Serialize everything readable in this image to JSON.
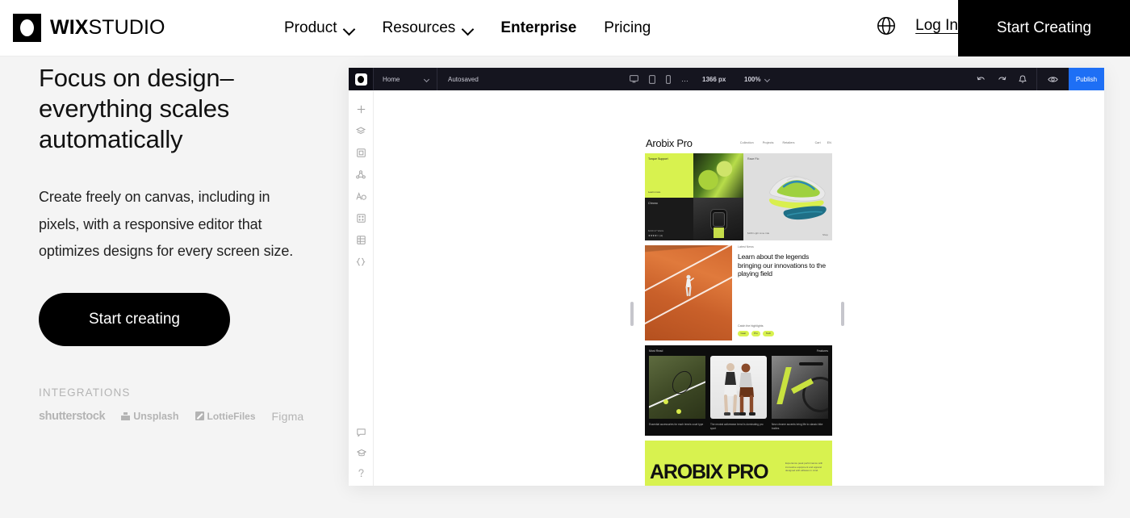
{
  "nav": {
    "brand": {
      "bold": "WIX",
      "light": "STUDIO"
    },
    "links": [
      {
        "label": "Product",
        "has_chevron": true,
        "bold": false
      },
      {
        "label": "Resources",
        "has_chevron": true,
        "bold": false
      },
      {
        "label": "Enterprise",
        "has_chevron": false,
        "bold": true
      },
      {
        "label": "Pricing",
        "has_chevron": false,
        "bold": false
      }
    ],
    "globe_icon": "globe-icon",
    "login": "Log In",
    "cta": "Start Creating"
  },
  "hero": {
    "heading": "Focus on design–everything scales automatically",
    "paragraph": "Create freely on canvas, including in pixels, with a responsive editor that optimizes designs for every screen size.",
    "button": "Start creating",
    "integrations_label": "INTEGRATIONS",
    "integrations": [
      {
        "name": "shutterstock",
        "icon": "shutterstock-logo"
      },
      {
        "name": "Unsplash",
        "icon": "unsplash-icon"
      },
      {
        "name": "LottieFiles",
        "icon": "lottiefiles-icon"
      },
      {
        "name": "Figma",
        "icon": "figma-logo"
      }
    ]
  },
  "editor": {
    "toolbar": {
      "logo_icon": "wix-logo-icon",
      "page_name": "Home",
      "save_status": "Autosaved",
      "devices": [
        "desktop-icon",
        "tablet-icon",
        "mobile-icon"
      ],
      "more": "…",
      "viewport_width": "1366 px",
      "zoom": "100%",
      "undo_icon": "undo-icon",
      "redo_icon": "redo-icon",
      "notifications_icon": "bell-icon",
      "preview_icon": "eye-icon",
      "publish": "Publish",
      "publish_color": "#1e6ff5"
    },
    "rail_top": [
      "add-icon",
      "layers-icon",
      "pages-icon",
      "connections-icon",
      "text-icon",
      "apps-icon",
      "cms-icon",
      "code-icon"
    ],
    "rail_bottom": [
      "comments-icon",
      "learn-icon",
      "help-icon"
    ]
  },
  "site": {
    "logo": "Arobix Pro",
    "nav": [
      "Collection",
      "Projects",
      "Retailers"
    ],
    "nav_right": [
      "Cart",
      "EN"
    ],
    "hero": {
      "tile_lime_title": "Torque Support",
      "tile_lime_sub": "Learn more",
      "tile_dark_title": "Chrono",
      "tile_dark_price": "$130\n27 Watts",
      "tile_dark_stars": "★★★★☆ (4)",
      "right_title": "Race Flo",
      "right_sub": "$180\nLight Lime ride",
      "right_link": "Shop"
    },
    "news": {
      "kicker": "Latest News",
      "headline": "Learn about the legends bringing our innovations to the playing field",
      "sub": "Catch the highlights",
      "tags": [
        "Gear",
        "Pro",
        "Tech"
      ]
    },
    "features": {
      "left_label": "Most Read",
      "right_label": "Features",
      "captions": [
        "Essential accessories for each tennis court type",
        "The neutral activewear trend is dominating pro sport",
        "New chrome accents bring life to classic bike bodies"
      ]
    },
    "banner": {
      "title": "AROBIX PRO",
      "note": "Experience peak performance with innovative equipment and apparel designed with athletes in mind."
    }
  },
  "colors": {
    "accent_lime": "#d8f24f",
    "publish_blue": "#1e6ff5",
    "editor_chrome": "#15151f",
    "page_background": "#f4f4f4"
  }
}
